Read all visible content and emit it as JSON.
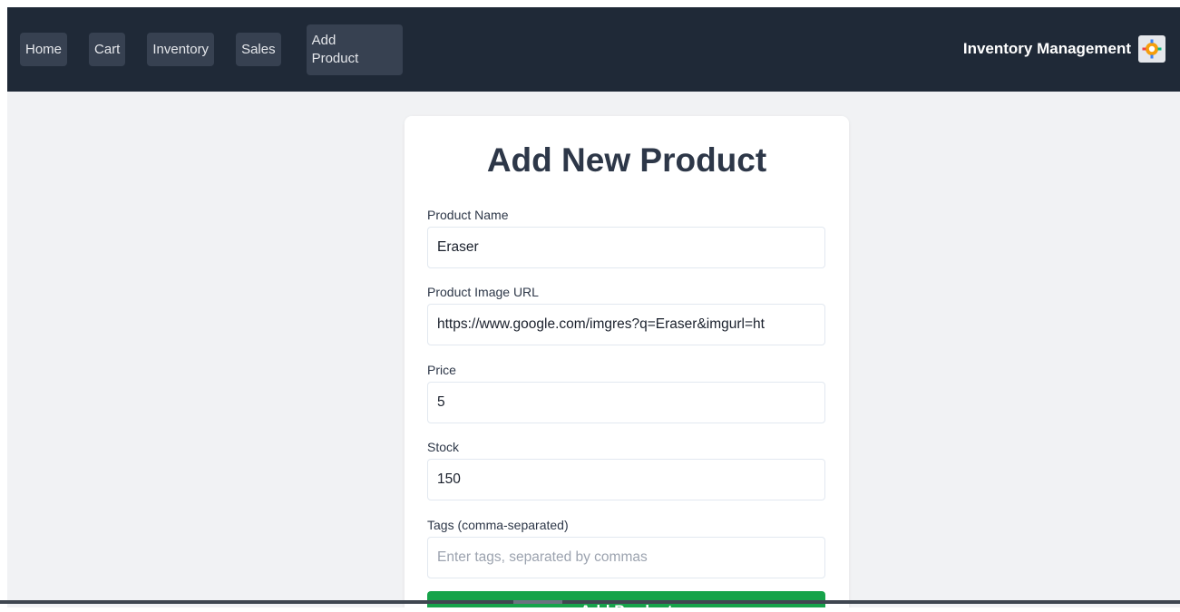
{
  "nav": {
    "links": [
      "Home",
      "Cart",
      "Inventory",
      "Sales"
    ],
    "active_line1": "Add",
    "active_line2": "Product",
    "brand": "Inventory Management",
    "brand_icon": "inventory-logo-icon"
  },
  "form": {
    "title": "Add New Product",
    "fields": {
      "name": {
        "label": "Product Name",
        "value": "Eraser"
      },
      "image_url": {
        "label": "Product Image URL",
        "value": "https://www.google.com/imgres?q=Eraser&imgurl=ht"
      },
      "price": {
        "label": "Price",
        "value": "5"
      },
      "stock": {
        "label": "Stock",
        "value": "150"
      },
      "tags": {
        "label": "Tags (comma-separated)",
        "placeholder": "Enter tags, separated by commas",
        "value": ""
      }
    },
    "submit_label": "Add Product"
  },
  "colors": {
    "navbar": "#1f2937",
    "nav_button": "#374151",
    "submit": "#16a34a",
    "page_bg": "#f1f2f4"
  }
}
